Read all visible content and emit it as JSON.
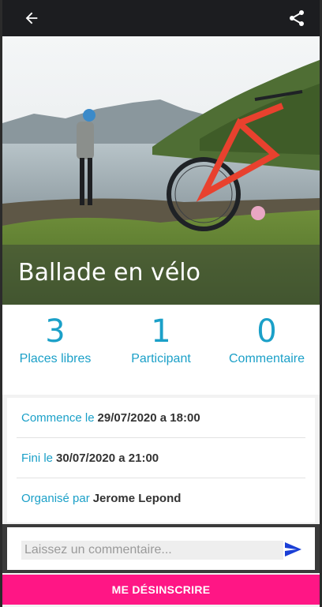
{
  "header": {
    "back_icon": "arrow-left-icon",
    "share_icon": "share-icon"
  },
  "event": {
    "title": "Ballade en vélo"
  },
  "stats": [
    {
      "value": "3",
      "label": "Places libres"
    },
    {
      "value": "1",
      "label": "Participant"
    },
    {
      "value": "0",
      "label": "Commentaire"
    }
  ],
  "details": {
    "start_label": "Commence le",
    "start_value": "29/07/2020 a 18:00",
    "end_label": "Fini le",
    "end_value": "30/07/2020 a 21:00",
    "organizer_label": "Organisé par",
    "organizer_value": "Jerome Lepond"
  },
  "comment": {
    "placeholder": "Laissez un commentaire...",
    "value": "",
    "send_icon": "send-icon"
  },
  "actions": {
    "unsubscribe_label": "ME DÉSINSCRIRE"
  },
  "colors": {
    "accent": "#1ba0c8",
    "unsubscribe": "#ff1685",
    "topbar": "#1c1d20",
    "send": "#1a3fd6"
  }
}
